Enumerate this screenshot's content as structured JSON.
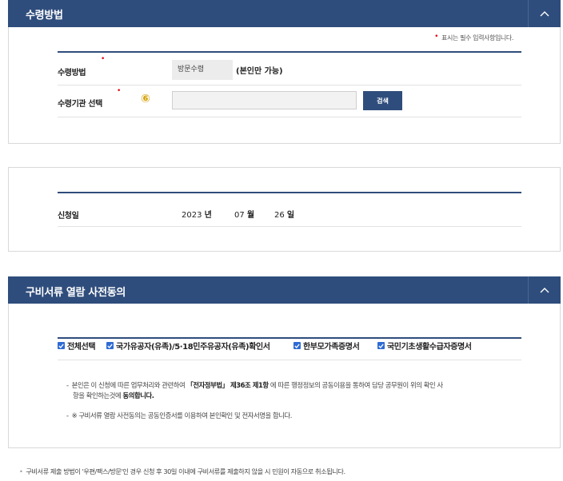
{
  "receive_section": {
    "title": "수령방법",
    "required_note": "표시는 필수 입력사항입니다.",
    "required_mark": "•",
    "method_label": "수령방법",
    "method_value": "방문수령",
    "method_note": "(본인만 가능)",
    "institution_label": "수령기관 선택",
    "step_marker": "⑥",
    "institution_value": "",
    "search_button": "검색",
    "toggle_icon": "chevron-up-icon"
  },
  "application_section": {
    "date_label": "신청일",
    "year": "2023",
    "year_unit": "년",
    "month": "07",
    "month_unit": "월",
    "day": "26",
    "day_unit": "일"
  },
  "consent_section": {
    "title": "구비서류 열람 사전동의",
    "toggle_icon": "chevron-up-icon",
    "checkboxes": [
      {
        "label": "전체선택",
        "checked": true
      },
      {
        "label": "국가유공자(유족)/5·18민주유공자(유족)확인서",
        "checked": true
      },
      {
        "label": "한부모가족증명서",
        "checked": true
      },
      {
        "label": "국민기초생활수급자증명서",
        "checked": true
      }
    ],
    "paragraph1_a": "본인은 이 신청에 따른 업무처리와 관련하여 ",
    "paragraph1_law": "「전자정부법」 제36조 제1항",
    "paragraph1_b": " 에 따른 행정정보의 공동이용을 통하여 담당 공무원이 위의 확인 사",
    "paragraph1_c": "항을 확인하는것에 ",
    "paragraph1_agree": "동의합니다.",
    "paragraph2": "※ 구비서류 열람 사전동의는 공동인증서를 이용하여 본인확인 및 전자서명을 합니다.",
    "dash": "-"
  },
  "footnote": {
    "bullet": "•",
    "text": "구비서류 제출 방법이 '우편/팩스/방문'인 경우 신청 후 30일 이내에 구비서류를 제출하지 않을 시 민원이 자동으로 취소됩니다."
  },
  "colors": {
    "header": "#2f4d7c",
    "required": "#e60012",
    "checkbox": "#2f6bd3",
    "step_marker": "#d39f00"
  }
}
